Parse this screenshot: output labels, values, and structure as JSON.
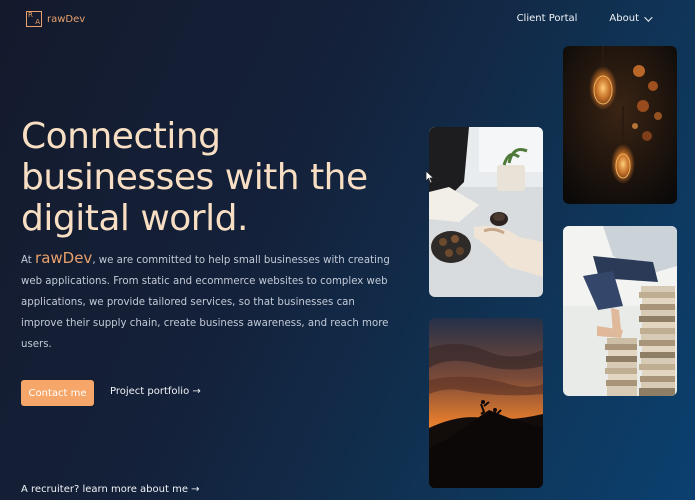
{
  "header": {
    "logo_letters": [
      "R",
      "A"
    ],
    "logo_text": "rawDev",
    "nav": {
      "client_portal": "Client Portal",
      "about": "About"
    }
  },
  "hero": {
    "headline": "Connecting businesses with the digital world.",
    "intro_prefix": "At ",
    "intro_brand": "rawDev",
    "intro_rest": ", we are committed to help small businesses with creating web applications. From static and ecommerce websites to complex web applications, we provide tailored services, so that businesses can improve their supply chain, create business awareness, and reach more users.",
    "contact_button": "Contact me",
    "portfolio_link": "Project portfolio →",
    "recruiter_link": "A recruiter? learn more about me →"
  },
  "colors": {
    "accent": "#f5a668",
    "brand": "#e9a06a",
    "headline": "#f8dfc4"
  },
  "images": [
    {
      "name": "edison-bulbs-photo"
    },
    {
      "name": "coffee-table-photo"
    },
    {
      "name": "stacked-books-photo"
    },
    {
      "name": "sunset-climbers-photo"
    }
  ]
}
